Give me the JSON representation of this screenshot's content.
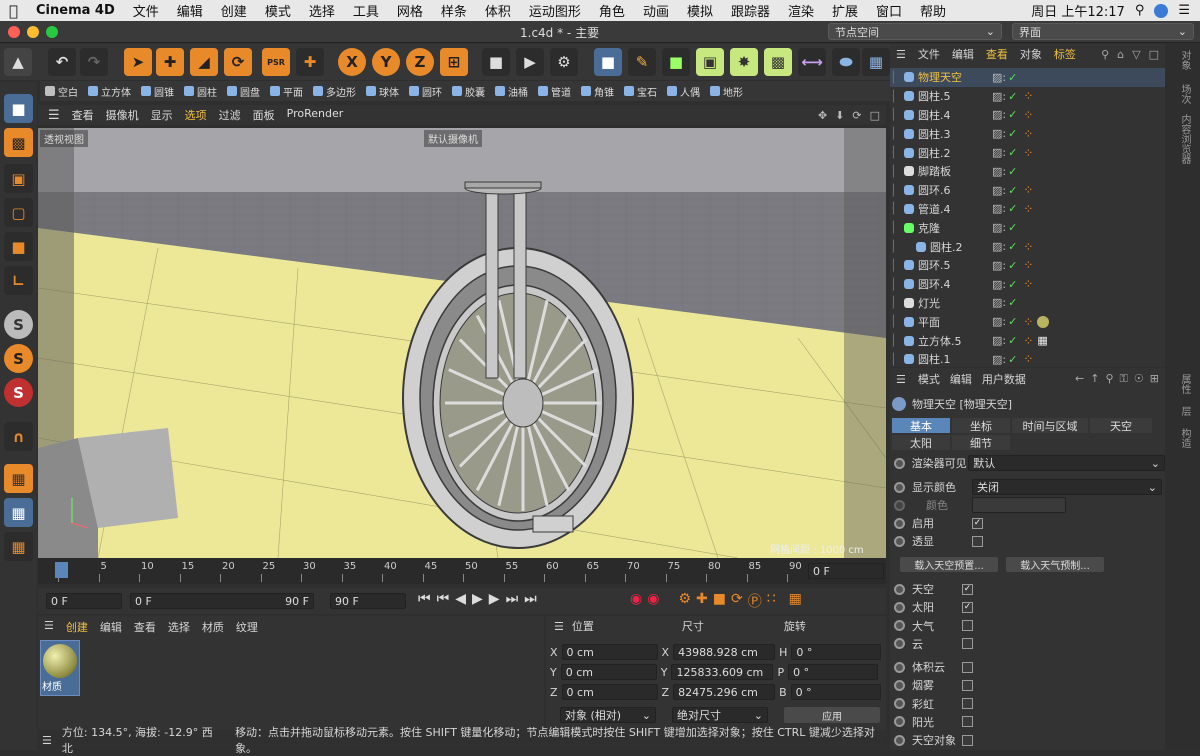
{
  "menubar": {
    "app": "Cinema 4D",
    "items": [
      "文件",
      "编辑",
      "创建",
      "模式",
      "选择",
      "工具",
      "网格",
      "样条",
      "体积",
      "运动图形",
      "角色",
      "动画",
      "模拟",
      "跟踪器",
      "渲染",
      "扩展",
      "窗口",
      "帮助"
    ],
    "clock": "周日 上午12:17"
  },
  "titlebar": {
    "title": "1.c4d * - 主要",
    "node_space": "节点空间",
    "layout": "界面"
  },
  "primitives": [
    "空白",
    "立方体",
    "圆锥",
    "圆柱",
    "圆盘",
    "平面",
    "多边形",
    "球体",
    "圆环",
    "胶囊",
    "油桶",
    "管道",
    "角锥",
    "宝石",
    "人偶",
    "地形"
  ],
  "viewport": {
    "menu": [
      "查看",
      "摄像机",
      "显示",
      "选项",
      "过滤",
      "面板",
      "ProRender"
    ],
    "active_menu": "选项",
    "view_label": "透视视图",
    "camera_label": "默认摄像机",
    "grid_label": "网格间距 : 1000 cm"
  },
  "timeline": {
    "ticks": [
      "0",
      "5",
      "10",
      "15",
      "20",
      "25",
      "30",
      "35",
      "40",
      "45",
      "50",
      "55",
      "60",
      "65",
      "70",
      "75",
      "80",
      "85",
      "90"
    ],
    "current": "0 F"
  },
  "transport": {
    "start": "0 F",
    "cur": "0 F",
    "end_inner": "90 F",
    "end": "90 F"
  },
  "material_panel": {
    "menu": [
      "创建",
      "编辑",
      "查看",
      "选择",
      "材质",
      "纹理"
    ],
    "material_name": "材质"
  },
  "coords": {
    "headers": [
      "位置",
      "尺寸",
      "旋转"
    ],
    "rows": [
      {
        "axis": "X",
        "pos": "0 cm",
        "size_axis": "X",
        "size": "43988.928 cm",
        "rot_axis": "H",
        "rot": "0 °"
      },
      {
        "axis": "Y",
        "pos": "0 cm",
        "size_axis": "Y",
        "size": "125833.609 cm",
        "rot_axis": "P",
        "rot": "0 °"
      },
      {
        "axis": "Z",
        "pos": "0 cm",
        "size_axis": "Z",
        "size": "82475.296 cm",
        "rot_axis": "B",
        "rot": "0 °"
      }
    ],
    "mode": "对象 (相对)",
    "size_mode": "绝对尺寸",
    "apply": "应用"
  },
  "status": {
    "left": "方位: 134.5°, 海拔: -12.9° 西北",
    "msg": "移动：点击并拖动鼠标移动元素。按住 SHIFT 键量化移动；节点编辑模式时按住 SHIFT 键增加选择对象；按住 CTRL 键减少选择对象。"
  },
  "objects": {
    "menu": [
      "文件",
      "编辑",
      "查看",
      "对象",
      "标签"
    ],
    "items": [
      {
        "name": "物理天空",
        "indent": 0,
        "selected": true
      },
      {
        "name": "圆柱.5",
        "indent": 0
      },
      {
        "name": "圆柱.4",
        "indent": 0
      },
      {
        "name": "圆柱.3",
        "indent": 0
      },
      {
        "name": "圆柱.2",
        "indent": 0
      },
      {
        "name": "脚踏板",
        "indent": 0
      },
      {
        "name": "圆环.6",
        "indent": 0
      },
      {
        "name": "管道.4",
        "indent": 0
      },
      {
        "name": "克隆",
        "indent": 0
      },
      {
        "name": "圆柱.2",
        "indent": 1
      },
      {
        "name": "圆环.5",
        "indent": 0
      },
      {
        "name": "圆环.4",
        "indent": 0
      },
      {
        "name": "灯光",
        "indent": 0
      },
      {
        "name": "平面",
        "indent": 0
      },
      {
        "name": "立方体.5",
        "indent": 0
      },
      {
        "name": "圆柱.1",
        "indent": 0
      }
    ]
  },
  "attributes": {
    "menu": [
      "模式",
      "编辑",
      "用户数据"
    ],
    "object_title": "物理天空 [物理天空]",
    "tabs_row1": [
      "基本",
      "坐标",
      "时间与区域",
      "天空"
    ],
    "tabs_row2": [
      "太阳",
      "细节"
    ],
    "active_tab": "基本",
    "render_visible_label": "渲染器可见",
    "render_visible_value": "默认",
    "display_color_label": "显示颜色",
    "display_color_value": "关闭",
    "color_label": "颜色",
    "enable_label": "启用",
    "transparent_label": "透显",
    "load_sky_preset": "载入天空预置...",
    "load_weather_preset": "载入天气预制...",
    "checks1": [
      {
        "label": "天空",
        "checked": true
      },
      {
        "label": "太阳",
        "checked": true
      },
      {
        "label": "大气",
        "checked": false
      },
      {
        "label": "云",
        "checked": false
      }
    ],
    "checks2": [
      {
        "label": "体积云",
        "checked": false
      },
      {
        "label": "烟雾",
        "checked": false
      },
      {
        "label": "彩虹",
        "checked": false
      },
      {
        "label": "阳光",
        "checked": false
      },
      {
        "label": "天空对象",
        "checked": false
      }
    ]
  },
  "side_tabs": {
    "top": [
      "对象",
      "场次",
      "内容浏览器"
    ],
    "bottom": [
      "属性",
      "层",
      "构造"
    ]
  }
}
